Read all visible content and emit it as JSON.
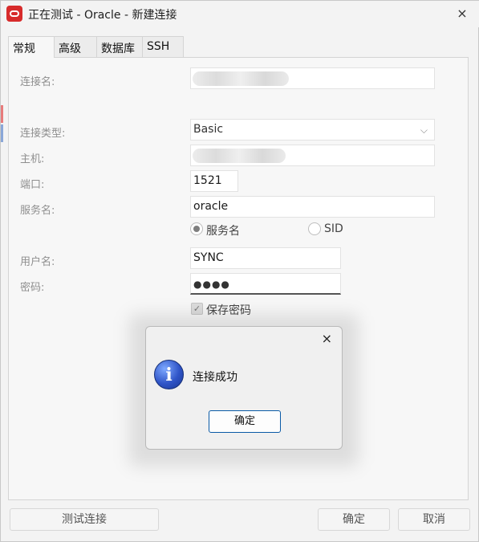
{
  "window": {
    "title": "正在测试 - Oracle - 新建连接",
    "close_icon": "×"
  },
  "tabs": [
    "常规",
    "高级",
    "数据库",
    "SSH"
  ],
  "form": {
    "conn_name_label": "连接名:",
    "conn_type_label": "连接类型:",
    "conn_type_value": "Basic",
    "host_label": "主机:",
    "port_label": "端口:",
    "port_value": "1521",
    "service_label": "服务名:",
    "service_value": "oracle",
    "radio_service": "服务名",
    "radio_sid": "SID",
    "user_label": "用户名:",
    "user_value": "SYNC",
    "password_label": "密码:",
    "password_value": "●●●●",
    "save_password": "保存密码"
  },
  "buttons": {
    "test": "测试连接",
    "ok": "确定",
    "cancel": "取消"
  },
  "dialog": {
    "message": "连接成功",
    "ok": "确定",
    "close_icon": "×",
    "info_icon": "i"
  }
}
